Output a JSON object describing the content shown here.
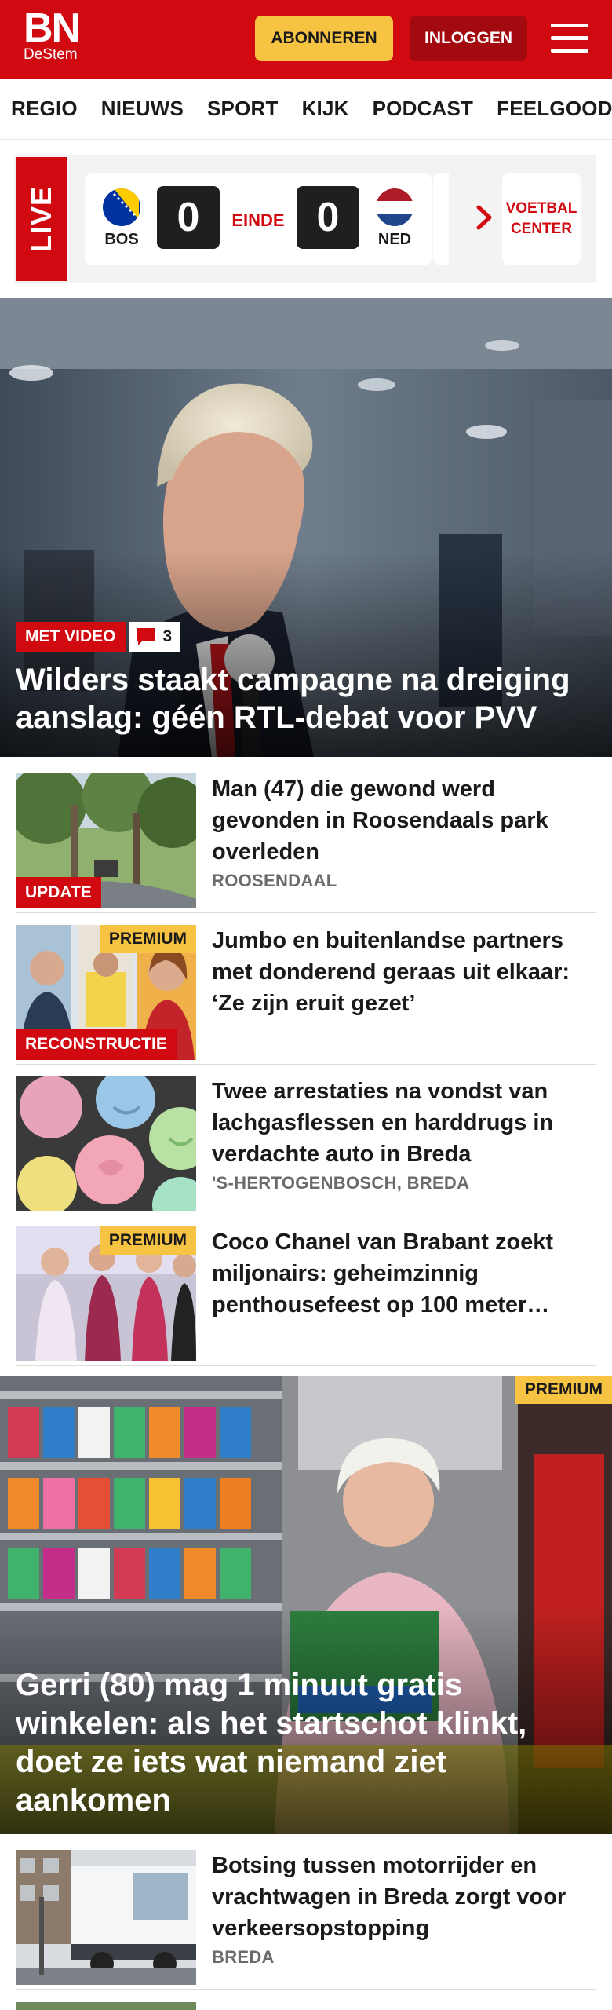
{
  "header": {
    "logo_main": "BN",
    "logo_sub": "DeStem",
    "subscribe_label": "ABONNEREN",
    "login_label": "INLOGGEN",
    "brand_color": "#d10a11",
    "accent_color": "#f6c343"
  },
  "nav": {
    "items": [
      "REGIO",
      "NIEUWS",
      "SPORT",
      "KIJK",
      "PODCAST",
      "FEELGOOD"
    ]
  },
  "live": {
    "label": "LIVE",
    "home_team": "BOS",
    "home_score": "0",
    "status": "EINDE",
    "away_score": "0",
    "away_team": "NED",
    "voetbal_center": "VOETBAL CENTER"
  },
  "hero": {
    "badge": "MET VIDEO",
    "comments": "3",
    "title": "Wilders staakt campagne na dreiging aanslag: géén RTL-debat voor PVV"
  },
  "articles": [
    {
      "title": "Man (47) die gewond werd gevonden in Roosendaals park overleden",
      "tag": "UPDATE",
      "location": "ROOSENDAAL",
      "premium": ""
    },
    {
      "title": "Jumbo en buitenlandse partners met donderend geraas uit elkaar: ‘Ze zijn eruit gezet’",
      "tag": "RECONSTRUCTIE",
      "location": "",
      "premium": "PREMIUM"
    },
    {
      "title": "Twee arrestaties na vondst van lachgasflessen en harddrugs in verdachte auto in Breda",
      "tag": "",
      "location": "'S-HERTOGENBOSCH, BREDA",
      "premium": ""
    },
    {
      "title": "Coco Chanel van Brabant zoekt miljonairs: geheimzinnig penthousefeest op 100 meter…",
      "tag": "",
      "location": "",
      "premium": "PREMIUM"
    }
  ],
  "feature": {
    "premium": "PREMIUM",
    "title": "Gerri (80) mag 1 minuut gratis winkelen: als het startschot klinkt, doet ze iets wat niemand ziet aankomen"
  },
  "articles_bottom": [
    {
      "title": "Botsing tussen motorrijder en vrachtwagen in Breda zorgt voor verkeersopstopping",
      "location": "BREDA"
    }
  ]
}
